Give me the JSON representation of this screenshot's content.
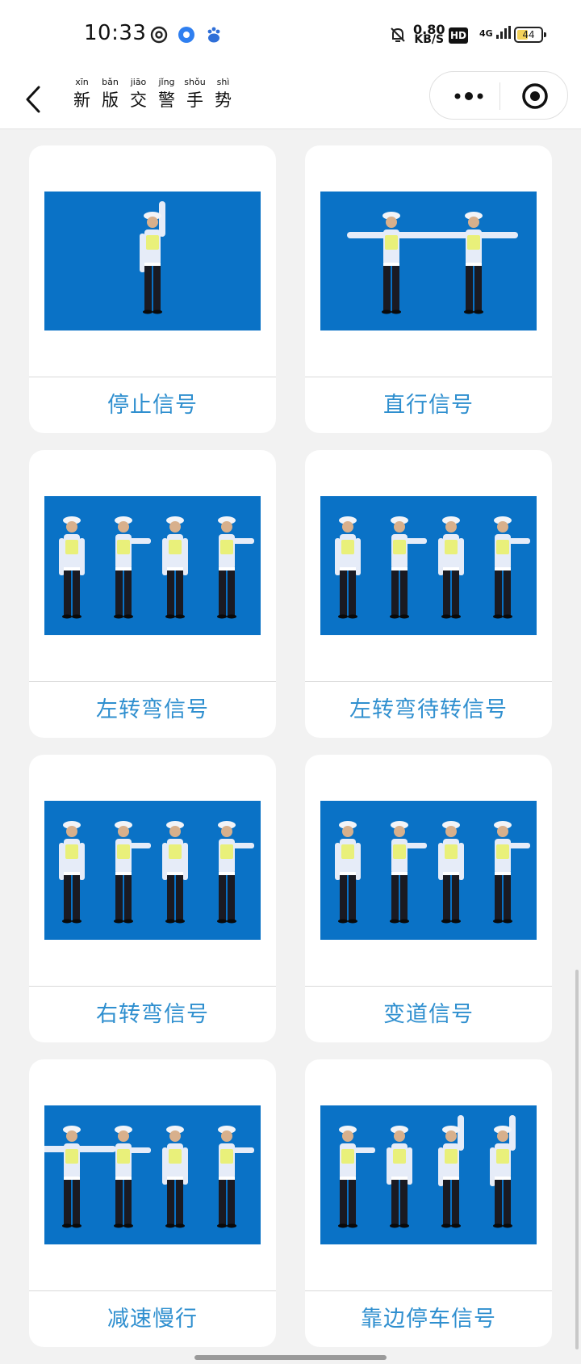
{
  "status": {
    "time": "10:33",
    "speed_value": "0.80",
    "speed_unit": "KB/S",
    "hd": "HD",
    "network": "4G",
    "battery": "44"
  },
  "nav": {
    "title": [
      {
        "py": "xīn",
        "hz": "新"
      },
      {
        "py": "bǎn",
        "hz": "版"
      },
      {
        "py": "jiāo",
        "hz": "交"
      },
      {
        "py": "jǐng",
        "hz": "警"
      },
      {
        "py": "shǒu",
        "hz": "手"
      },
      {
        "py": "shì",
        "hz": "势"
      }
    ]
  },
  "cards": [
    {
      "label": "停止信号"
    },
    {
      "label": "直行信号"
    },
    {
      "label": "左转弯信号"
    },
    {
      "label": "左转弯待转信号"
    },
    {
      "label": "右转弯信号"
    },
    {
      "label": "变道信号"
    },
    {
      "label": "减速慢行"
    },
    {
      "label": "靠边停车信号"
    }
  ],
  "colors": {
    "photo_bg": "#0a72c6",
    "label": "#2f8fcf",
    "page_bg": "#f2f2f2"
  }
}
